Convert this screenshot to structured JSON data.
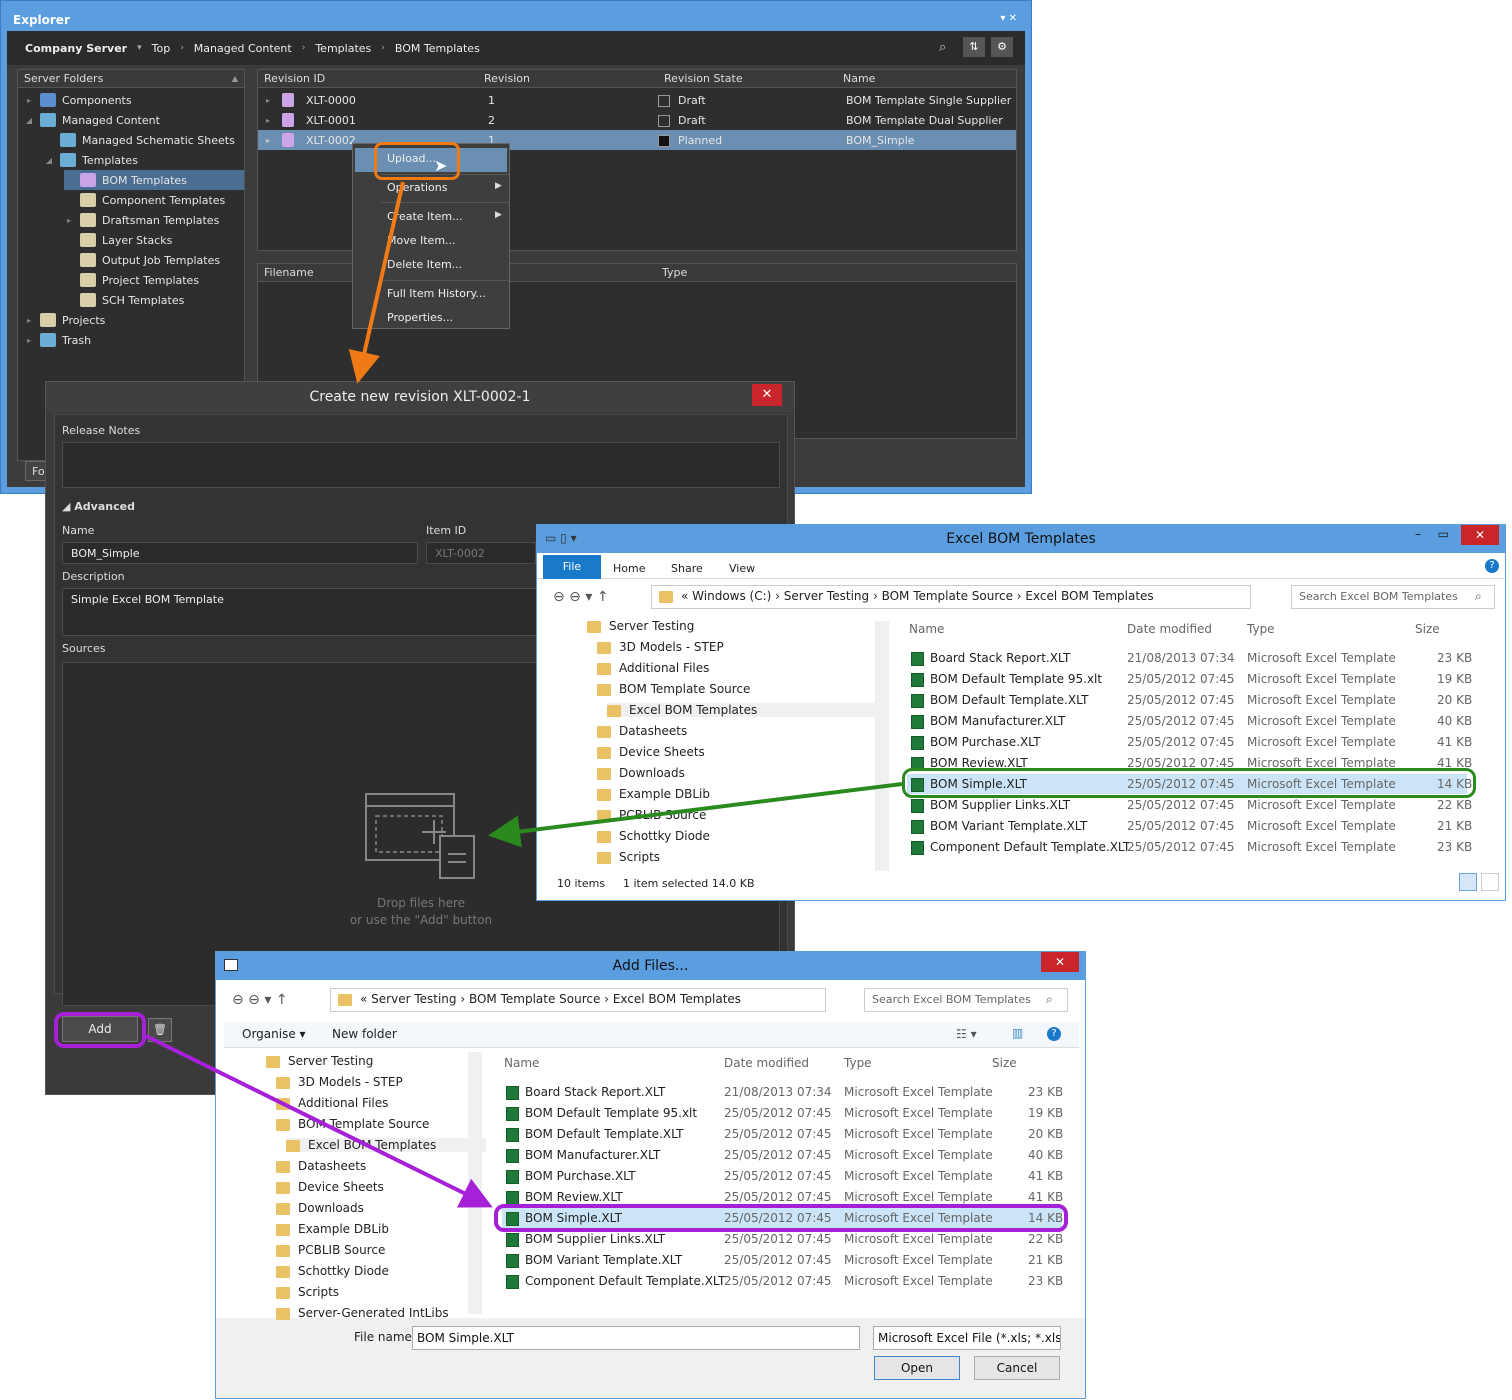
{
  "explorer": {
    "title": "Explorer",
    "breadcrumb": [
      "Company Server",
      "Top",
      "Managed Content",
      "Templates",
      "BOM Templates"
    ],
    "folders_header": "Server Folders",
    "folders": [
      {
        "label": "Components",
        "depth": 1
      },
      {
        "label": "Managed Content",
        "depth": 1
      },
      {
        "label": "Managed Schematic Sheets",
        "depth": 2
      },
      {
        "label": "Templates",
        "depth": 2
      },
      {
        "label": "BOM Templates",
        "depth": 3,
        "selected": true
      },
      {
        "label": "Component Templates",
        "depth": 3
      },
      {
        "label": "Draftsman Templates",
        "depth": 3
      },
      {
        "label": "Layer Stacks",
        "depth": 3
      },
      {
        "label": "Output Job Templates",
        "depth": 3
      },
      {
        "label": "Project Templates",
        "depth": 3
      },
      {
        "label": "SCH Templates",
        "depth": 3
      },
      {
        "label": "Projects",
        "depth": 1
      },
      {
        "label": "Trash",
        "depth": 1
      }
    ],
    "bottom_tab": "Fol",
    "columns": [
      "Revision ID",
      "Revision",
      "Revision State",
      "Name"
    ],
    "rows": [
      {
        "id": "XLT-0000",
        "rev": "1",
        "state": "Draft",
        "name": "BOM Template Single Supplier"
      },
      {
        "id": "XLT-0001",
        "rev": "2",
        "state": "Draft",
        "name": "BOM Template Dual Supplier"
      },
      {
        "id": "XLT-0002",
        "rev": "1",
        "state": "Planned",
        "name": "BOM_Simple"
      }
    ],
    "files_columns": [
      "Filename",
      "Type"
    ]
  },
  "context_menu": [
    "Upload...",
    "Operations",
    "Create Item...",
    "Move Item...",
    "Delete Item...",
    "Full Item History...",
    "Properties..."
  ],
  "dialog": {
    "title": "Create new revision XLT-0002-1",
    "release_notes": "Release Notes",
    "advanced": "Advanced",
    "name_label": "Name",
    "name_value": "BOM_Simple",
    "item_id_label": "Item ID",
    "item_id_value": "XLT-0002",
    "description_label": "Description",
    "description_value": "Simple Excel BOM Template",
    "sources_label": "Sources",
    "drop_line1": "Drop files here",
    "drop_line2": "or use the \"Add\" button",
    "add_button": "Add"
  },
  "win_explorer": {
    "title": "Excel BOM Templates",
    "ribbon": [
      "File",
      "Home",
      "Share",
      "View"
    ],
    "path": [
      "Windows (C:)",
      "Server Testing",
      "BOM Template Source",
      "Excel BOM Templates"
    ],
    "search_placeholder": "Search Excel BOM Templates",
    "tree": [
      "Server Testing",
      "3D Models - STEP",
      "Additional Files",
      "BOM Template Source",
      "Excel BOM Templates",
      "Datasheets",
      "Device Sheets",
      "Downloads",
      "Example DBLib",
      "PCBLIB Source",
      "Schottky Diode",
      "Scripts"
    ],
    "columns": [
      "Name",
      "Date modified",
      "Type",
      "Size"
    ],
    "status_items": "10 items",
    "status_selected": "1 item selected  14.0 KB"
  },
  "files": [
    {
      "name": "Board Stack Report.XLT",
      "date": "21/08/2013 07:34",
      "type": "Microsoft Excel Template",
      "size": "23 KB"
    },
    {
      "name": "BOM Default Template 95.xlt",
      "date": "25/05/2012 07:45",
      "type": "Microsoft Excel Template",
      "size": "19 KB"
    },
    {
      "name": "BOM Default Template.XLT",
      "date": "25/05/2012 07:45",
      "type": "Microsoft Excel Template",
      "size": "20 KB"
    },
    {
      "name": "BOM Manufacturer.XLT",
      "date": "25/05/2012 07:45",
      "type": "Microsoft Excel Template",
      "size": "40 KB"
    },
    {
      "name": "BOM Purchase.XLT",
      "date": "25/05/2012 07:45",
      "type": "Microsoft Excel Template",
      "size": "41 KB"
    },
    {
      "name": "BOM Review.XLT",
      "date": "25/05/2012 07:45",
      "type": "Microsoft Excel Template",
      "size": "41 KB"
    },
    {
      "name": "BOM Simple.XLT",
      "date": "25/05/2012 07:45",
      "type": "Microsoft Excel Template",
      "size": "14 KB"
    },
    {
      "name": "BOM Supplier Links.XLT",
      "date": "25/05/2012 07:45",
      "type": "Microsoft Excel Template",
      "size": "22 KB"
    },
    {
      "name": "BOM Variant Template.XLT",
      "date": "25/05/2012 07:45",
      "type": "Microsoft Excel Template",
      "size": "21 KB"
    },
    {
      "name": "Component Default Template.XLT",
      "date": "25/05/2012 07:45",
      "type": "Microsoft Excel Template",
      "size": "23 KB"
    }
  ],
  "add_files": {
    "title": "Add Files...",
    "path": [
      "Server Testing",
      "BOM Template Source",
      "Excel BOM Templates"
    ],
    "search_placeholder": "Search Excel BOM Templates",
    "organise": "Organise",
    "new_folder": "New folder",
    "tree": [
      "Server Testing",
      "3D Models - STEP",
      "Additional Files",
      "BOM Template Source",
      "Excel BOM Templates",
      "Datasheets",
      "Device Sheets",
      "Downloads",
      "Example DBLib",
      "PCBLIB Source",
      "Schottky Diode",
      "Scripts",
      "Server-Generated IntLibs"
    ],
    "file_name_label": "File name:",
    "file_name_value": "BOM Simple.XLT",
    "filter": "Microsoft Excel File (*.xls; *.xlsx;",
    "open": "Open",
    "cancel": "Cancel"
  },
  "colors": {
    "accent_orange": "#f07a15",
    "accent_green": "#2a8a1e",
    "accent_purple": "#a620d8",
    "selection": "#6a8fb3"
  }
}
